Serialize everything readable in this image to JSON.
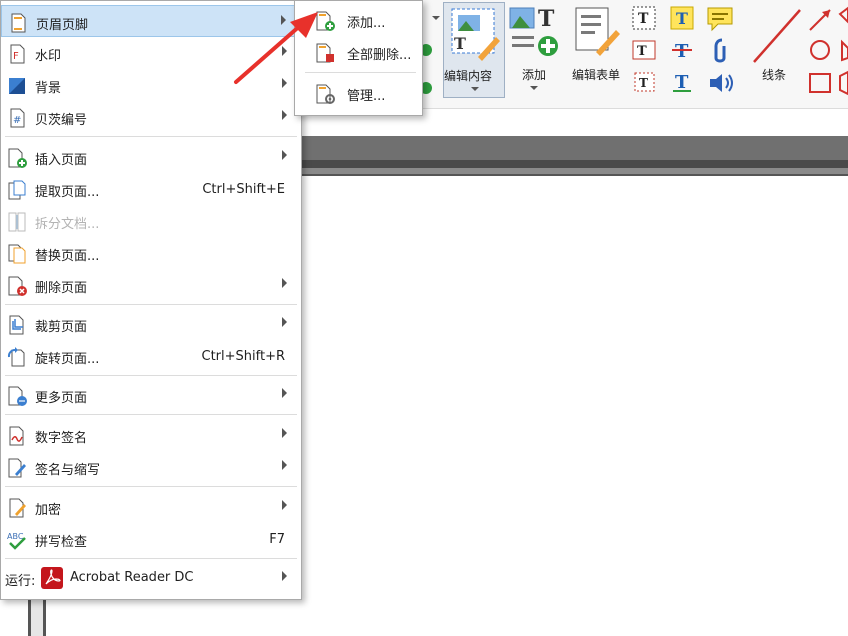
{
  "ribbon": {
    "edit_content_label": "编辑内容",
    "add_label": "添加",
    "edit_form_label": "编辑表单",
    "lines_label": "线条"
  },
  "main_menu": {
    "header_footer": "页眉页脚",
    "watermark": "水印",
    "background": "背景",
    "bates": "贝茨编号",
    "insert_page": "插入页面",
    "extract_page": "提取页面...",
    "extract_shortcut": "Ctrl+Shift+E",
    "split_doc": "拆分文档...",
    "replace_page": "替换页面...",
    "delete_page": "删除页面",
    "crop_page": "裁剪页面",
    "rotate_page": "旋转页面...",
    "rotate_shortcut": "Ctrl+Shift+R",
    "more_pages": "更多页面",
    "digital_signature": "数字签名",
    "sign_initial": "签名与缩写",
    "encrypt": "加密",
    "spell_check": "拼写检查",
    "spell_shortcut": "F7",
    "run_label": "运行:",
    "run_app": "Acrobat Reader DC"
  },
  "sub_menu": {
    "add": "添加...",
    "delete_all": "全部删除...",
    "manage": "管理..."
  },
  "colors": {
    "highlight": "#cde3f7",
    "arrow": "#e8312b",
    "menu_border": "#a9a9a9"
  }
}
